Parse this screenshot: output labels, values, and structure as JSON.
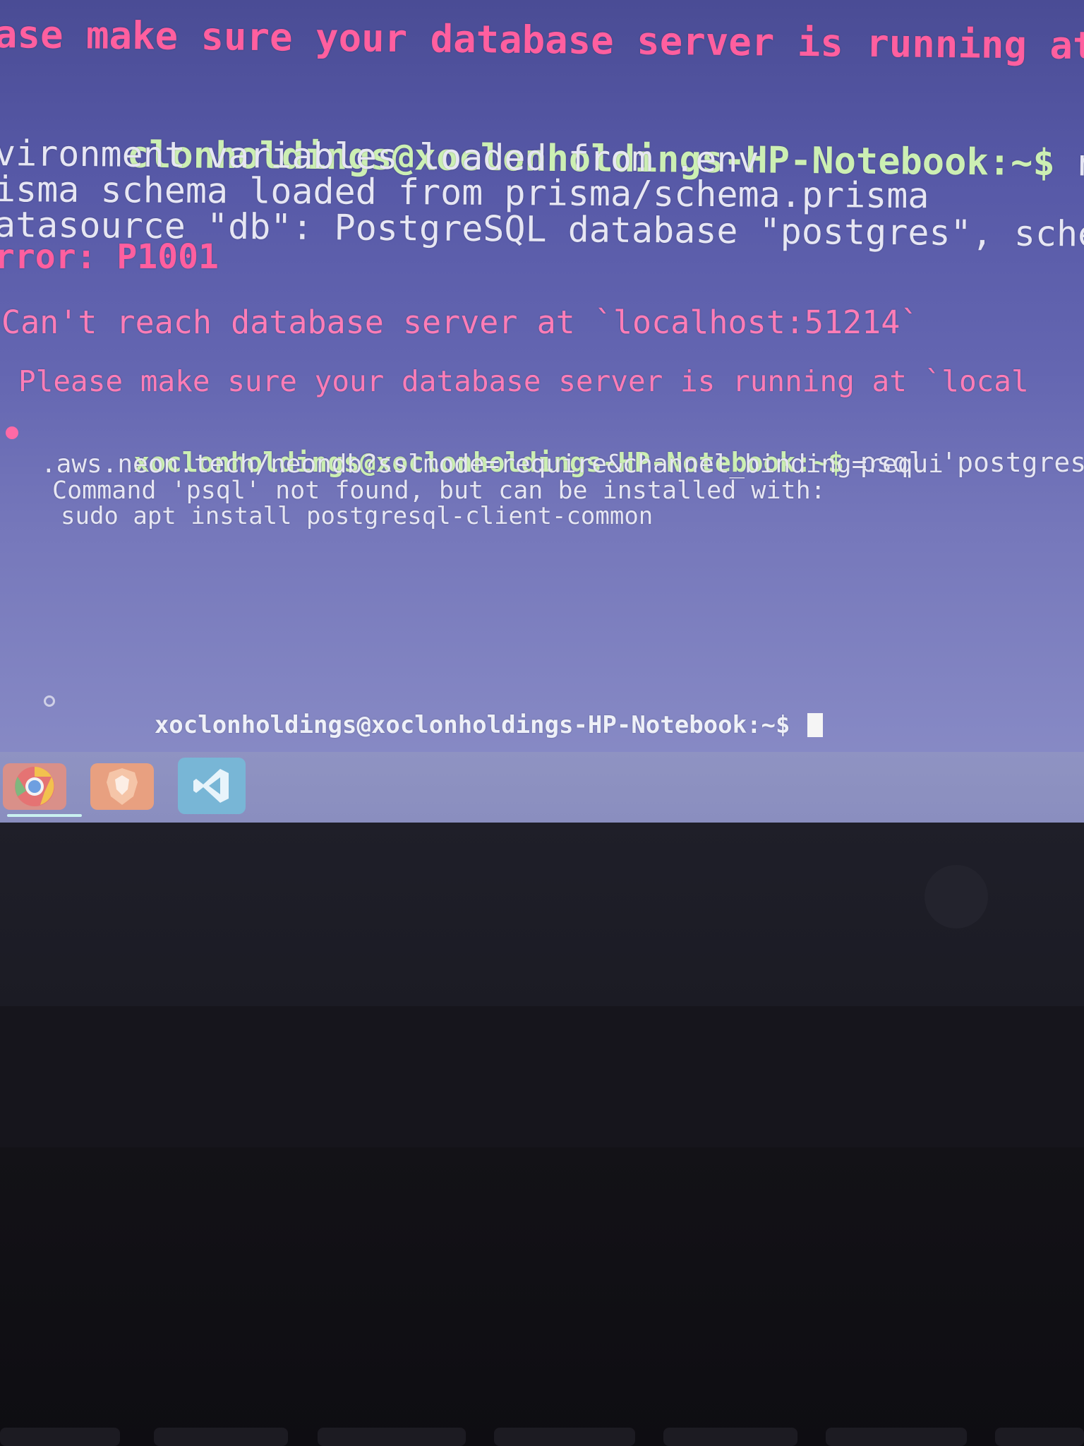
{
  "terminal": {
    "lines": [
      {
        "text": "ase make sure your database server is running at `",
        "style": "pink"
      },
      {
        "prompt": "clonholdings@xoclonholdings-HP-Notebook:~$",
        "command": " npx prism"
      },
      {
        "text": "vironment variables loaded from .env",
        "style": "light"
      },
      {
        "text": "isma schema loaded from prisma/schema.prisma",
        "style": "light"
      },
      {
        "text": "atasource \"db\": PostgreSQL database \"postgres\", schema",
        "style": "light"
      },
      {
        "text": "rror: P1001",
        "style": "pink"
      },
      {
        "text": "Can't reach database server at `localhost:51214`",
        "style": "pink"
      },
      {
        "text": "Please make sure your database server is running at `local",
        "style": "pink"
      },
      {
        "prompt": "xoclonholdings@xoclonholdings-HP-Notebook:~$",
        "command": " psql 'postgres"
      },
      {
        "text": ".aws.neon.tech/neondb?sslmode=require&channel_binding=requi",
        "style": "light"
      },
      {
        "text": "Command 'psql' not found, but can be installed with:",
        "style": "light"
      },
      {
        "text": "sudo apt install postgresql-client-common",
        "style": "light"
      },
      {
        "prompt": "xoclonholdings@xoclonholdings-HP-Notebook:~$",
        "command": " "
      }
    ]
  },
  "taskbar": {
    "apps": [
      {
        "icon": "chrome-icon",
        "active": true
      },
      {
        "icon": "brave-icon",
        "active": false
      },
      {
        "icon": "vscode-icon",
        "active": true
      }
    ]
  },
  "colors": {
    "error": "#ff5f9f",
    "prompt": "#ccefb3",
    "text": "#e6e6f3",
    "terminal_bg": "#5759a7"
  }
}
